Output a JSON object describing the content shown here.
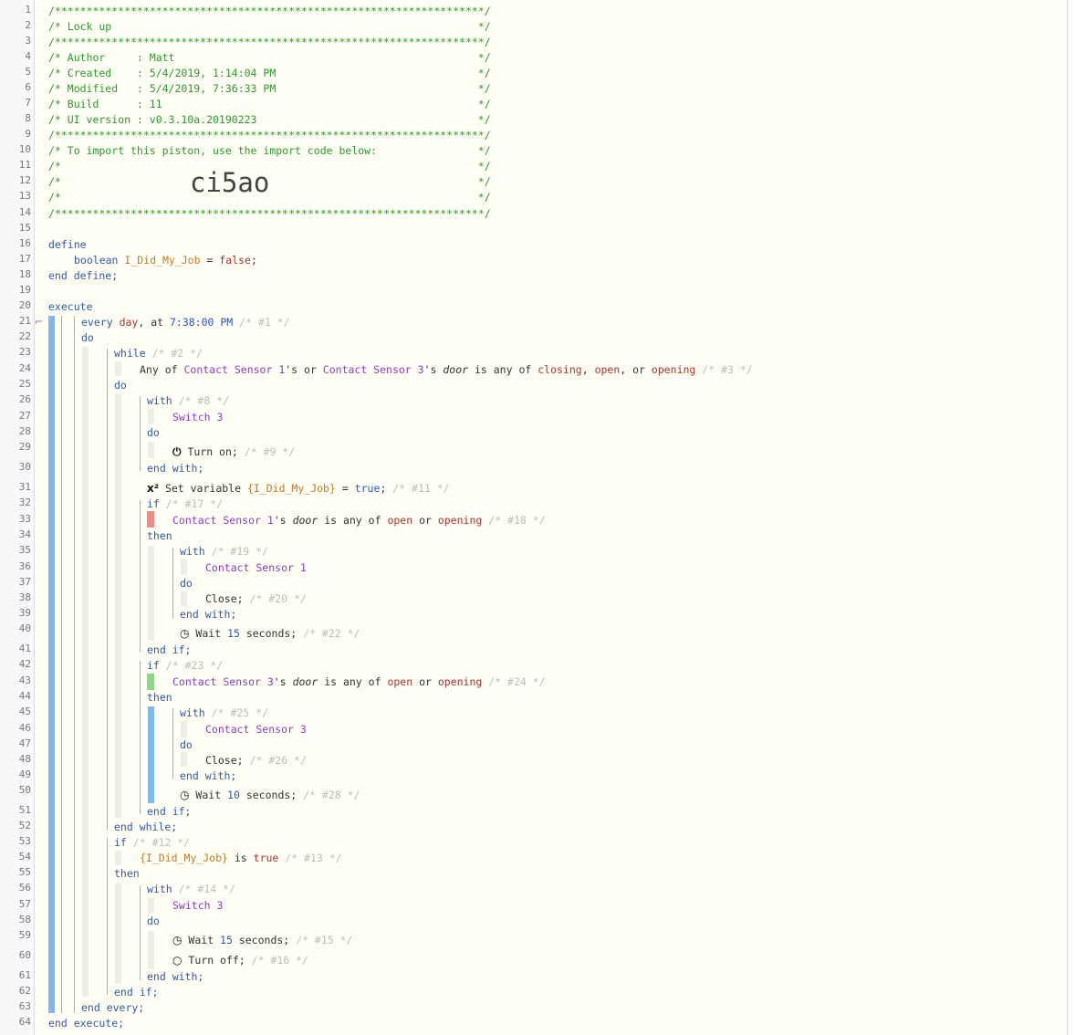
{
  "header_comments": [
    "/********************************************************************/",
    "/* Lock up                                                          */",
    "/********************************************************************/",
    "/* Author     : Matt                                                */",
    "/* Created    : 5/4/2019, 1:14:04 PM                                */",
    "/* Modified   : 5/4/2019, 7:36:33 PM                                */",
    "/* Build      : 11                                                  */",
    "/* UI version : v0.3.10a.20190223                                   */",
    "/********************************************************************/",
    "/* To import this piston, use the import code below:                */",
    "/*                                                                  */",
    "/*                                                                  */",
    "/*                                                                  */",
    "/********************************************************************/"
  ],
  "import_code": "ci5ao",
  "line_numbers": [
    "1",
    "2",
    "3",
    "4",
    "5",
    "6",
    "7",
    "8",
    "9",
    "10",
    "11",
    "12",
    "13",
    "14",
    "15",
    "16",
    "17",
    "18",
    "19",
    "20",
    "21",
    "22",
    "23",
    "24",
    "25",
    "26",
    "27",
    "28",
    "29",
    "30",
    "31",
    "32",
    "33",
    "34",
    "35",
    "36",
    "37",
    "38",
    "39",
    "40",
    "41",
    "42",
    "43",
    "44",
    "45",
    "46",
    "47",
    "48",
    "49",
    "50",
    "51",
    "52",
    "53",
    "54",
    "55",
    "56",
    "57",
    "58",
    "59",
    "60",
    "61",
    "62",
    "63",
    "64"
  ],
  "code": {
    "define": "define",
    "boolean": "boolean",
    "var_name": "I_Did_My_Job",
    "eq_false": " = ",
    "false": "false",
    "semi": ";",
    "end_define": "end define;",
    "execute": "execute",
    "every": "every",
    "day": "day",
    "comma_at": ", at ",
    "time": "7:38:00 PM",
    "c1": "/* #1 */",
    "do": "do",
    "while": "while",
    "c2": "/* #2 */",
    "any_of": "Any of ",
    "cs1": "Contact Sensor 1",
    "s_or": "'s or ",
    "cs3": "Contact Sensor 3",
    "s": "'s ",
    "door": "door",
    "is_any_of": " is any of ",
    "closing": "closing",
    "comma": ", ",
    "open": "open",
    "comma_or": ", or ",
    "opening": "opening",
    "c3": "/* #3 */",
    "with": "with",
    "c8": "/* #8 */",
    "switch3": "Switch 3",
    "turn_on": "Turn on;",
    "c9": "/* #9 */",
    "end_with": "end with;",
    "x2": "x²",
    "set_variable": "Set variable ",
    "var_ref": "{I_Did_My_Job}",
    "eq": " = ",
    "true": "true",
    "c11": "/* #11 */",
    "if": "if",
    "c17": "/* #17 */",
    "or": " or ",
    "c18": "/* #18 */",
    "then": "then",
    "c19": "/* #19 */",
    "close": "Close;",
    "c20": "/* #20 */",
    "wait": "Wait ",
    "n15": "15",
    "seconds": " seconds;",
    "c22": "/* #22 */",
    "end_if": "end if;",
    "c23": "/* #23 */",
    "c24": "/* #24 */",
    "c25": "/* #25 */",
    "c26": "/* #26 */",
    "n10": "10",
    "c28": "/* #28 */",
    "end_while": "end while;",
    "c12": "/* #12 */",
    "is": " is ",
    "c13": "/* #13 */",
    "c14": "/* #14 */",
    "c15": "/* #15 */",
    "turn_off": "Turn off;",
    "c16": "/* #16 */",
    "end_every": "end every;",
    "end_execute": "end execute;"
  },
  "colors": {
    "comment": "#2a9a2a",
    "keyword": "#2f5aa8",
    "device": "#8a3cd0",
    "value": "#b03030",
    "number": "#2a55c8",
    "variable": "#c57a20",
    "dim": "#bdbdbd",
    "condition_false": "#f28b82",
    "condition_true": "#8bd88b",
    "bar_blue": "#7fb7f0"
  },
  "icons": [
    "power-icon",
    "clock-icon",
    "x-squared-icon",
    "power-off-icon",
    "fold-icon"
  ]
}
